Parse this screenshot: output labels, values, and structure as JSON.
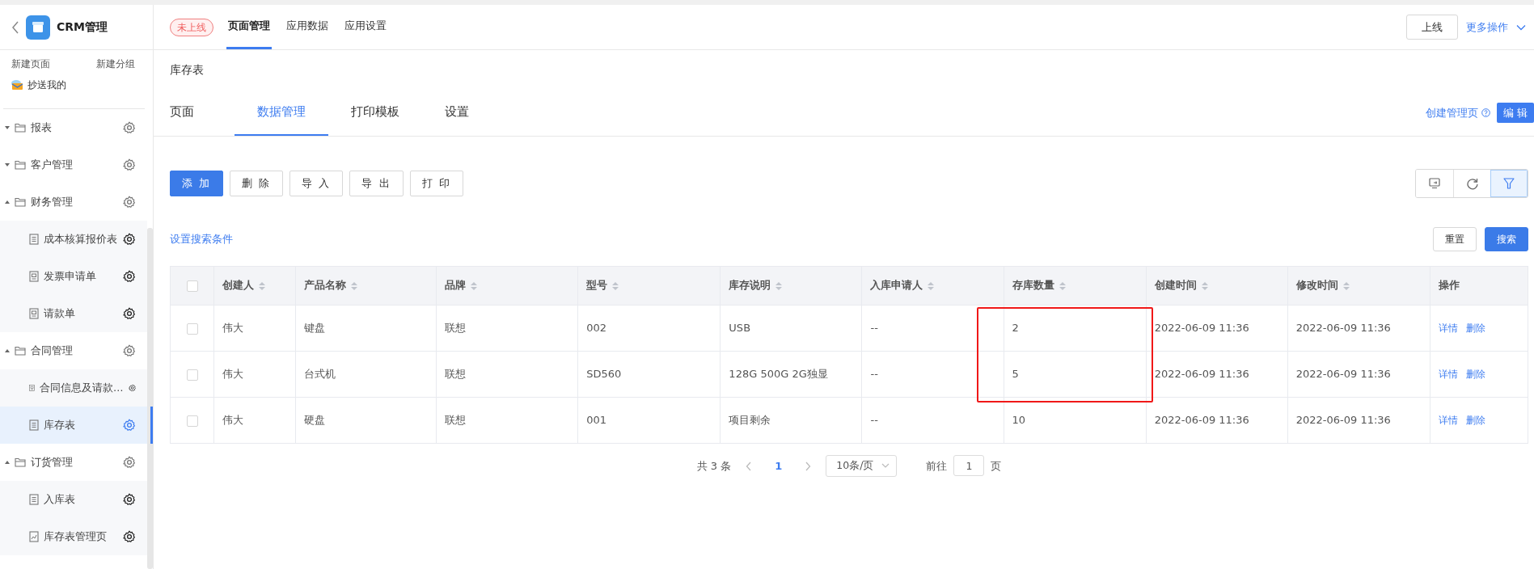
{
  "app": {
    "title": "CRM管理"
  },
  "status_badge": "未上线",
  "top_tabs": [
    {
      "label": "页面管理",
      "selected": true
    },
    {
      "label": "应用数据",
      "selected": false
    },
    {
      "label": "应用设置",
      "selected": false
    }
  ],
  "publish_button": "上线",
  "more_actions": "更多操作",
  "sidebar": {
    "actions": [
      "新建页面",
      "新建分组"
    ],
    "cc_me": "抄送我的",
    "items": [
      {
        "label": "报表",
        "kind": "group",
        "expanded": false,
        "selected": false
      },
      {
        "label": "客户管理",
        "kind": "group",
        "expanded": false,
        "selected": false
      },
      {
        "label": "财务管理",
        "kind": "group",
        "expanded": true,
        "selected": false,
        "children": [
          {
            "label": "成本核算报价表",
            "kind": "list",
            "selected": false
          },
          {
            "label": "发票申请单",
            "kind": "form",
            "selected": false
          },
          {
            "label": "请款单",
            "kind": "form",
            "selected": false
          }
        ]
      },
      {
        "label": "合同管理",
        "kind": "group",
        "expanded": true,
        "selected": false,
        "children": [
          {
            "label": "合同信息及请款…",
            "kind": "form",
            "selected": false
          },
          {
            "label": "库存表",
            "kind": "list",
            "selected": true
          }
        ]
      },
      {
        "label": "订货管理",
        "kind": "group",
        "expanded": true,
        "selected": false,
        "children": [
          {
            "label": "入库表",
            "kind": "list",
            "selected": false
          },
          {
            "label": "库存表管理页",
            "kind": "report",
            "selected": false
          }
        ]
      }
    ]
  },
  "page_title": "库存表",
  "page_tabs": [
    {
      "label": "页面",
      "selected": false
    },
    {
      "label": "数据管理",
      "selected": true
    },
    {
      "label": "打印模板",
      "selected": false
    },
    {
      "label": "设置",
      "selected": false
    }
  ],
  "create_manage_page": "创建管理页",
  "edit_button": "编 辑",
  "toolbar": [
    "添 加",
    "删 除",
    "导 入",
    "导 出",
    "打 印"
  ],
  "view_tools": [
    {
      "kind": "display",
      "selected": false
    },
    {
      "kind": "refresh",
      "selected": false
    },
    {
      "kind": "filter",
      "selected": true
    }
  ],
  "search_conditions_link": "设置搜索条件",
  "reset_button": "重置",
  "search_button": "搜索",
  "table": {
    "select_all": {
      "checked": false
    },
    "columns": [
      "创建人",
      "产品名称",
      "品牌",
      "型号",
      "库存说明",
      "入库申请人",
      "存库数量",
      "创建时间",
      "修改时间",
      "操作"
    ],
    "rows": [
      {
        "checked": false,
        "highlighted": true,
        "cells": [
          "伟大",
          "键盘",
          "联想",
          "002",
          "USB",
          "--",
          "2",
          "2022-06-09 11:36",
          "2022-06-09 11:36"
        ],
        "actions": [
          "详情",
          "删除"
        ]
      },
      {
        "checked": false,
        "highlighted": true,
        "cells": [
          "伟大",
          "台式机",
          "联想",
          "SD560",
          "128G 500G 2G独显",
          "--",
          "5",
          "2022-06-09 11:36",
          "2022-06-09 11:36"
        ],
        "actions": [
          "详情",
          "删除"
        ]
      },
      {
        "checked": false,
        "highlighted": false,
        "cells": [
          "伟大",
          "硬盘",
          "联想",
          "001",
          "项目剩余",
          "--",
          "10",
          "2022-06-09 11:36",
          "2022-06-09 11:36"
        ],
        "actions": [
          "详情",
          "删除"
        ]
      }
    ]
  },
  "pagination": {
    "total": "共 3 条",
    "pages": [
      {
        "label": "1",
        "selected": true
      }
    ],
    "page_size": "10条/页",
    "goto_label": "前往",
    "goto_value": "1",
    "page_suffix": "页"
  }
}
